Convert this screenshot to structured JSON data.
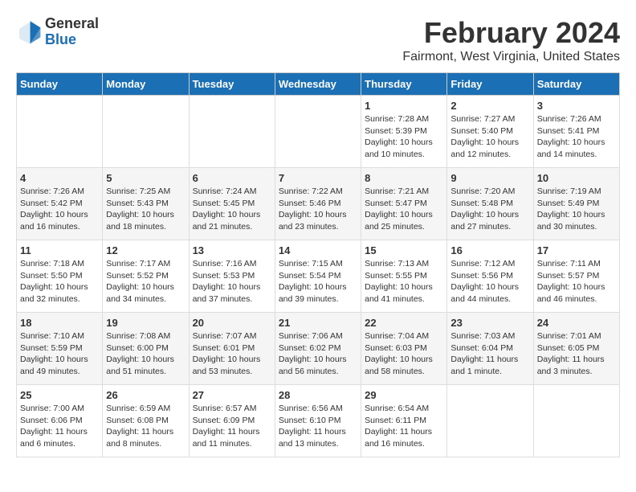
{
  "header": {
    "logo_general": "General",
    "logo_blue": "Blue",
    "month_title": "February 2024",
    "location": "Fairmont, West Virginia, United States"
  },
  "days_of_week": [
    "Sunday",
    "Monday",
    "Tuesday",
    "Wednesday",
    "Thursday",
    "Friday",
    "Saturday"
  ],
  "weeks": [
    [
      {
        "num": "",
        "info": ""
      },
      {
        "num": "",
        "info": ""
      },
      {
        "num": "",
        "info": ""
      },
      {
        "num": "",
        "info": ""
      },
      {
        "num": "1",
        "info": "Sunrise: 7:28 AM\nSunset: 5:39 PM\nDaylight: 10 hours\nand 10 minutes."
      },
      {
        "num": "2",
        "info": "Sunrise: 7:27 AM\nSunset: 5:40 PM\nDaylight: 10 hours\nand 12 minutes."
      },
      {
        "num": "3",
        "info": "Sunrise: 7:26 AM\nSunset: 5:41 PM\nDaylight: 10 hours\nand 14 minutes."
      }
    ],
    [
      {
        "num": "4",
        "info": "Sunrise: 7:26 AM\nSunset: 5:42 PM\nDaylight: 10 hours\nand 16 minutes."
      },
      {
        "num": "5",
        "info": "Sunrise: 7:25 AM\nSunset: 5:43 PM\nDaylight: 10 hours\nand 18 minutes."
      },
      {
        "num": "6",
        "info": "Sunrise: 7:24 AM\nSunset: 5:45 PM\nDaylight: 10 hours\nand 21 minutes."
      },
      {
        "num": "7",
        "info": "Sunrise: 7:22 AM\nSunset: 5:46 PM\nDaylight: 10 hours\nand 23 minutes."
      },
      {
        "num": "8",
        "info": "Sunrise: 7:21 AM\nSunset: 5:47 PM\nDaylight: 10 hours\nand 25 minutes."
      },
      {
        "num": "9",
        "info": "Sunrise: 7:20 AM\nSunset: 5:48 PM\nDaylight: 10 hours\nand 27 minutes."
      },
      {
        "num": "10",
        "info": "Sunrise: 7:19 AM\nSunset: 5:49 PM\nDaylight: 10 hours\nand 30 minutes."
      }
    ],
    [
      {
        "num": "11",
        "info": "Sunrise: 7:18 AM\nSunset: 5:50 PM\nDaylight: 10 hours\nand 32 minutes."
      },
      {
        "num": "12",
        "info": "Sunrise: 7:17 AM\nSunset: 5:52 PM\nDaylight: 10 hours\nand 34 minutes."
      },
      {
        "num": "13",
        "info": "Sunrise: 7:16 AM\nSunset: 5:53 PM\nDaylight: 10 hours\nand 37 minutes."
      },
      {
        "num": "14",
        "info": "Sunrise: 7:15 AM\nSunset: 5:54 PM\nDaylight: 10 hours\nand 39 minutes."
      },
      {
        "num": "15",
        "info": "Sunrise: 7:13 AM\nSunset: 5:55 PM\nDaylight: 10 hours\nand 41 minutes."
      },
      {
        "num": "16",
        "info": "Sunrise: 7:12 AM\nSunset: 5:56 PM\nDaylight: 10 hours\nand 44 minutes."
      },
      {
        "num": "17",
        "info": "Sunrise: 7:11 AM\nSunset: 5:57 PM\nDaylight: 10 hours\nand 46 minutes."
      }
    ],
    [
      {
        "num": "18",
        "info": "Sunrise: 7:10 AM\nSunset: 5:59 PM\nDaylight: 10 hours\nand 49 minutes."
      },
      {
        "num": "19",
        "info": "Sunrise: 7:08 AM\nSunset: 6:00 PM\nDaylight: 10 hours\nand 51 minutes."
      },
      {
        "num": "20",
        "info": "Sunrise: 7:07 AM\nSunset: 6:01 PM\nDaylight: 10 hours\nand 53 minutes."
      },
      {
        "num": "21",
        "info": "Sunrise: 7:06 AM\nSunset: 6:02 PM\nDaylight: 10 hours\nand 56 minutes."
      },
      {
        "num": "22",
        "info": "Sunrise: 7:04 AM\nSunset: 6:03 PM\nDaylight: 10 hours\nand 58 minutes."
      },
      {
        "num": "23",
        "info": "Sunrise: 7:03 AM\nSunset: 6:04 PM\nDaylight: 11 hours\nand 1 minute."
      },
      {
        "num": "24",
        "info": "Sunrise: 7:01 AM\nSunset: 6:05 PM\nDaylight: 11 hours\nand 3 minutes."
      }
    ],
    [
      {
        "num": "25",
        "info": "Sunrise: 7:00 AM\nSunset: 6:06 PM\nDaylight: 11 hours\nand 6 minutes."
      },
      {
        "num": "26",
        "info": "Sunrise: 6:59 AM\nSunset: 6:08 PM\nDaylight: 11 hours\nand 8 minutes."
      },
      {
        "num": "27",
        "info": "Sunrise: 6:57 AM\nSunset: 6:09 PM\nDaylight: 11 hours\nand 11 minutes."
      },
      {
        "num": "28",
        "info": "Sunrise: 6:56 AM\nSunset: 6:10 PM\nDaylight: 11 hours\nand 13 minutes."
      },
      {
        "num": "29",
        "info": "Sunrise: 6:54 AM\nSunset: 6:11 PM\nDaylight: 11 hours\nand 16 minutes."
      },
      {
        "num": "",
        "info": ""
      },
      {
        "num": "",
        "info": ""
      }
    ]
  ]
}
